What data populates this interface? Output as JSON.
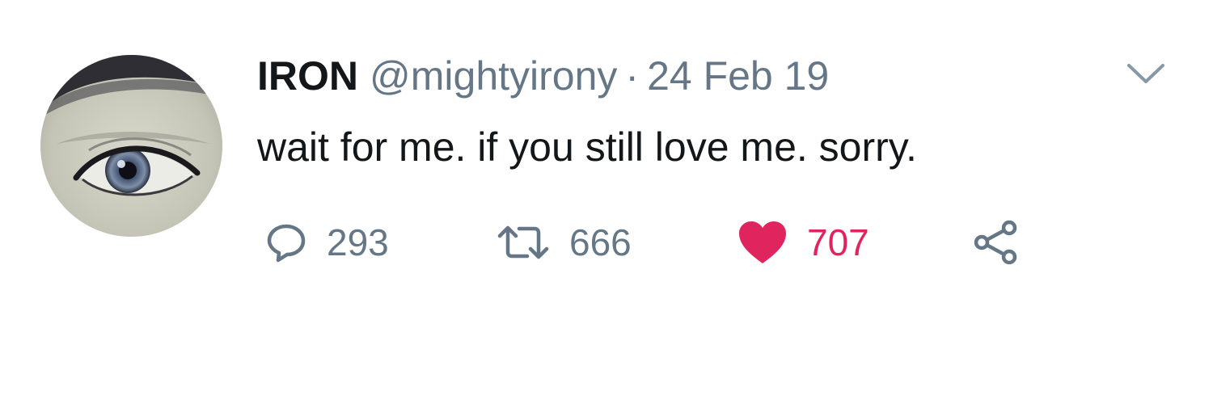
{
  "tweet": {
    "author_name": "IRON",
    "author_handle": "@mightyirony",
    "separator": "·",
    "date": "24 Feb 19",
    "text": "wait for me. if you still love me. sorry."
  },
  "actions": {
    "replies": "293",
    "retweets": "666",
    "likes": "707",
    "liked": true
  },
  "icons": {
    "reply": "reply-bubble-icon",
    "retweet": "retweet-arrows-icon",
    "like": "heart-icon",
    "share": "share-icon",
    "menu": "chevron-down-icon"
  },
  "colors": {
    "text_primary": "#14171a",
    "text_secondary": "#657786",
    "like_red": "#e0245e",
    "background": "#ffffff"
  }
}
